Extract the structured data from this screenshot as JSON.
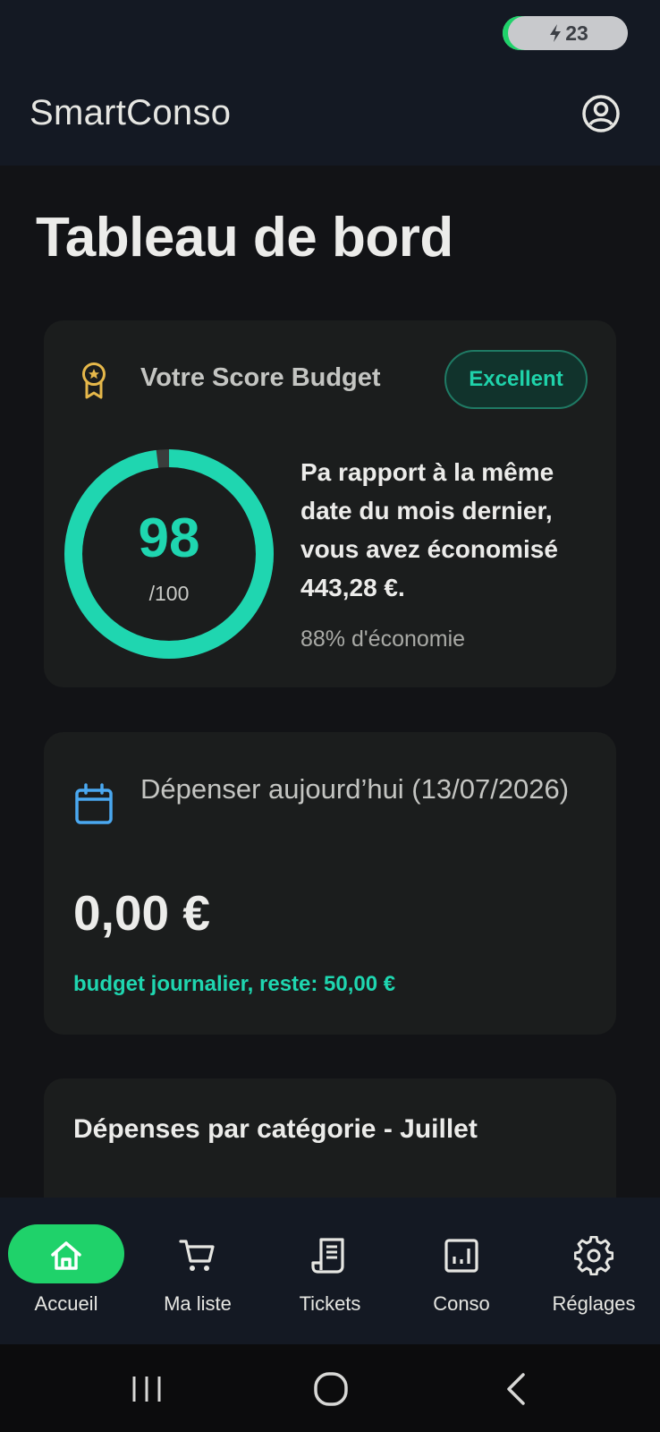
{
  "status": {
    "battery_level": "23",
    "battery_fraction": 0.23
  },
  "app_bar": {
    "title": "SmartConso",
    "profile_icon": "account-circle-icon"
  },
  "page": {
    "title": "Tableau de bord"
  },
  "score_card": {
    "title": "Votre Score Budget",
    "badge": "Excellent",
    "score": "98",
    "score_max": "/100",
    "score_fraction": 0.98,
    "description": "Pa rapport à la même date du mois dernier, vous avez économisé 443,28 €.",
    "savings_percent": "88% d'économie",
    "icon": "medal-icon",
    "accent": "#1fd6b0"
  },
  "today_card": {
    "title": "Dépenser aujourd’hui (13/07/2026)",
    "amount": "0,00 €",
    "note": "budget journalier, reste: 50,00 €",
    "icon": "calendar-icon"
  },
  "category_card": {
    "title": "Dépenses par catégorie - Juillet"
  },
  "nav": {
    "items": [
      {
        "label": "Accueil",
        "icon": "home-icon",
        "active": true
      },
      {
        "label": "Ma liste",
        "icon": "cart-icon",
        "active": false
      },
      {
        "label": "Tickets",
        "icon": "receipt-icon",
        "active": false
      },
      {
        "label": "Conso",
        "icon": "chart-icon",
        "active": false
      },
      {
        "label": "Réglages",
        "icon": "gear-icon",
        "active": false
      }
    ],
    "active_color": "#1fd26a"
  },
  "system_nav": {
    "buttons": [
      "recent-apps-icon",
      "home-circle-icon",
      "back-icon"
    ]
  }
}
